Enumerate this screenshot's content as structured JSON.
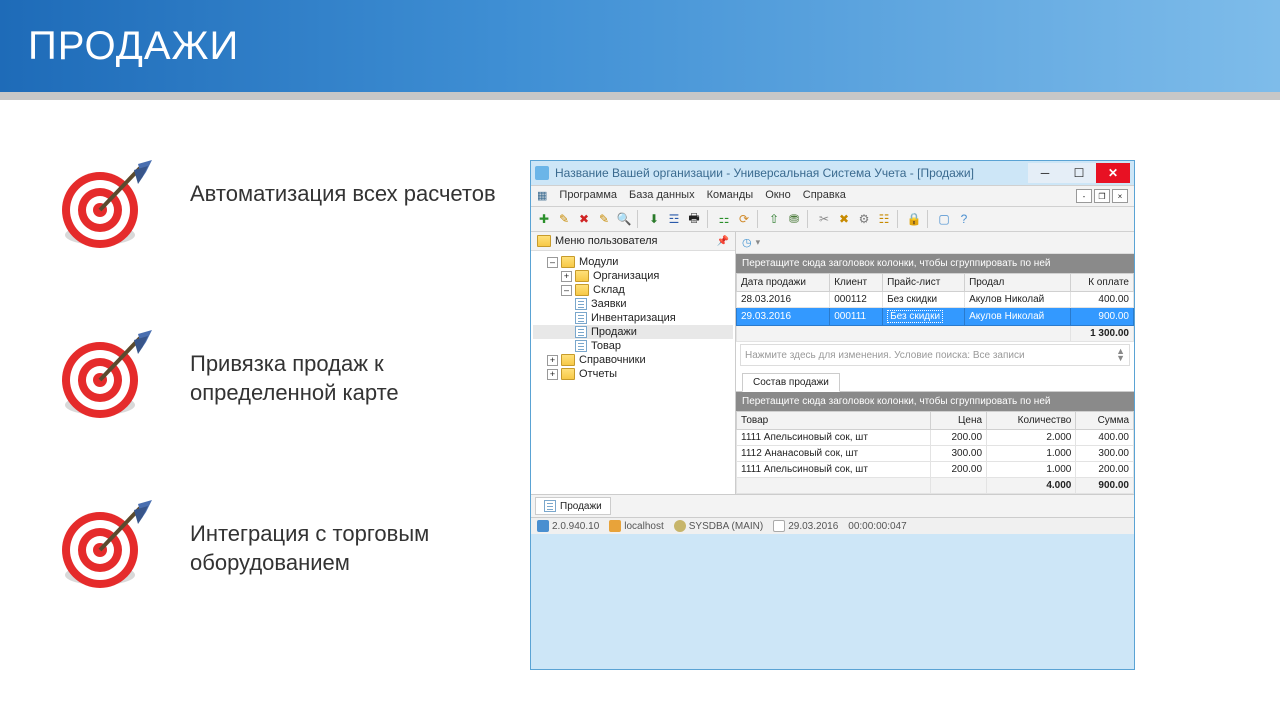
{
  "slide": {
    "title": "ПРОДАЖИ",
    "bullets": [
      "Автоматизация всех расчетов",
      "Привязка продаж к определенной карте",
      "Интеграция с торговым оборудованием"
    ]
  },
  "app": {
    "window_title": "Название Вашей организации - Универсальная Система Учета - [Продажи]",
    "menu": [
      "Программа",
      "База данных",
      "Команды",
      "Окно",
      "Справка"
    ],
    "user_menu_panel": "Меню пользователя",
    "tree": {
      "root": "Модули",
      "org": "Организация",
      "warehouse": "Склад",
      "warehouse_children": [
        "Заявки",
        "Инвентаризация",
        "Продажи",
        "Товар"
      ],
      "refs": "Справочники",
      "reports": "Отчеты"
    },
    "group_hint": "Перетащите сюда заголовок колонки, чтобы сгруппировать по ней",
    "sales_grid": {
      "headers": [
        "Дата продажи",
        "Клиент",
        "Прайс-лист",
        "Продал",
        "К оплате"
      ],
      "rows": [
        {
          "date": "28.03.2016",
          "client": "000112",
          "price": "Без скидки",
          "seller": "Акулов Николай",
          "amount": "400.00"
        },
        {
          "date": "29.03.2016",
          "client": "000111",
          "price": "Без скидки",
          "seller": "Акулов Николай",
          "amount": "900.00"
        }
      ],
      "total": "1 300.00"
    },
    "search_hint": "Нажмите здесь для изменения. Условие поиска: Все записи",
    "detail_tab": "Состав продажи",
    "detail_grid": {
      "headers": [
        "Товар",
        "Цена",
        "Количество",
        "Сумма"
      ],
      "rows": [
        {
          "name": "1111 Апельсиновый сок, шт",
          "price": "200.00",
          "qty": "2.000",
          "sum": "400.00"
        },
        {
          "name": "1112 Ананасовый сок, шт",
          "price": "300.00",
          "qty": "1.000",
          "sum": "300.00"
        },
        {
          "name": "1111 Апельсиновый сок, шт",
          "price": "200.00",
          "qty": "1.000",
          "sum": "200.00"
        }
      ],
      "total_qty": "4.000",
      "total_sum": "900.00"
    },
    "doc_tab": "Продажи",
    "status": {
      "version": "2.0.940.10",
      "host": "localhost",
      "user": "SYSDBA (MAIN)",
      "date": "29.03.2016",
      "time": "00:00:00:047"
    }
  }
}
